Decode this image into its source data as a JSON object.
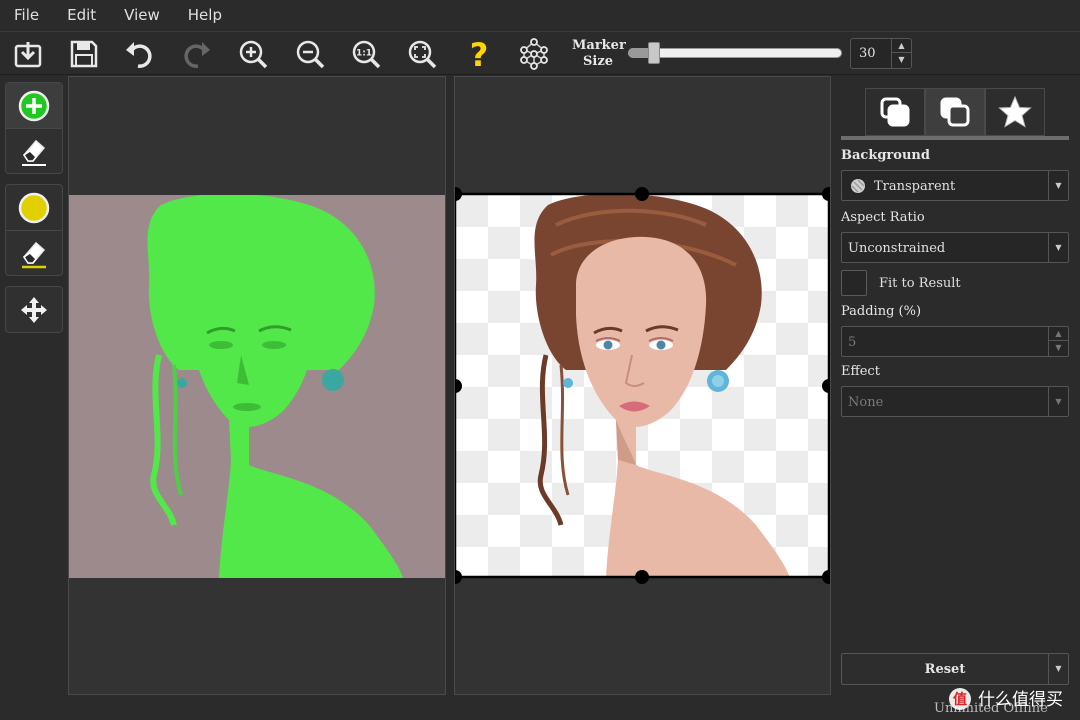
{
  "menu": {
    "items": [
      {
        "label": "File"
      },
      {
        "label": "Edit"
      },
      {
        "label": "View"
      },
      {
        "label": "Help"
      }
    ]
  },
  "toolbar": {
    "buttons": [
      "open-icon",
      "save-icon",
      "undo-icon",
      "redo-icon",
      "zoom-in-icon",
      "zoom-out-icon",
      "zoom-actual-icon",
      "zoom-fit-icon",
      "help-icon",
      "network-icon"
    ],
    "zoom_actual_text": "1:1",
    "help_text": "?",
    "marker_label_line1": "Marker",
    "marker_label_line2": "Size",
    "marker_size": "30",
    "marker_size_value": 30,
    "marker_size_max": 100
  },
  "lefttools": {
    "groups": [
      [
        "foreground-marker-icon",
        "foreground-eraser-icon"
      ],
      [
        "hair-marker-icon",
        "hair-eraser-icon"
      ],
      [
        "move-icon"
      ]
    ],
    "colors": {
      "foreground": "#22c822",
      "hair": "#e0d000"
    }
  },
  "panel": {
    "tabs": [
      "copy-icon",
      "layers-icon",
      "star-icon"
    ],
    "background_label": "Background",
    "background_value": "Transparent",
    "aspect_label": "Aspect Ratio",
    "aspect_value": "Unconstrained",
    "fit_label": "Fit to Result",
    "padding_label": "Padding (%)",
    "padding_value": "5",
    "effect_label": "Effect",
    "effect_value": "None",
    "reset_label": "Reset"
  },
  "footer": {
    "status": "Unlimited Offline",
    "watermark_text": "什么值得买"
  },
  "colors": {
    "mask_green": "#52e84a",
    "photo_bg": "#9d8a8c",
    "accent_yellow": "#ffd400"
  }
}
